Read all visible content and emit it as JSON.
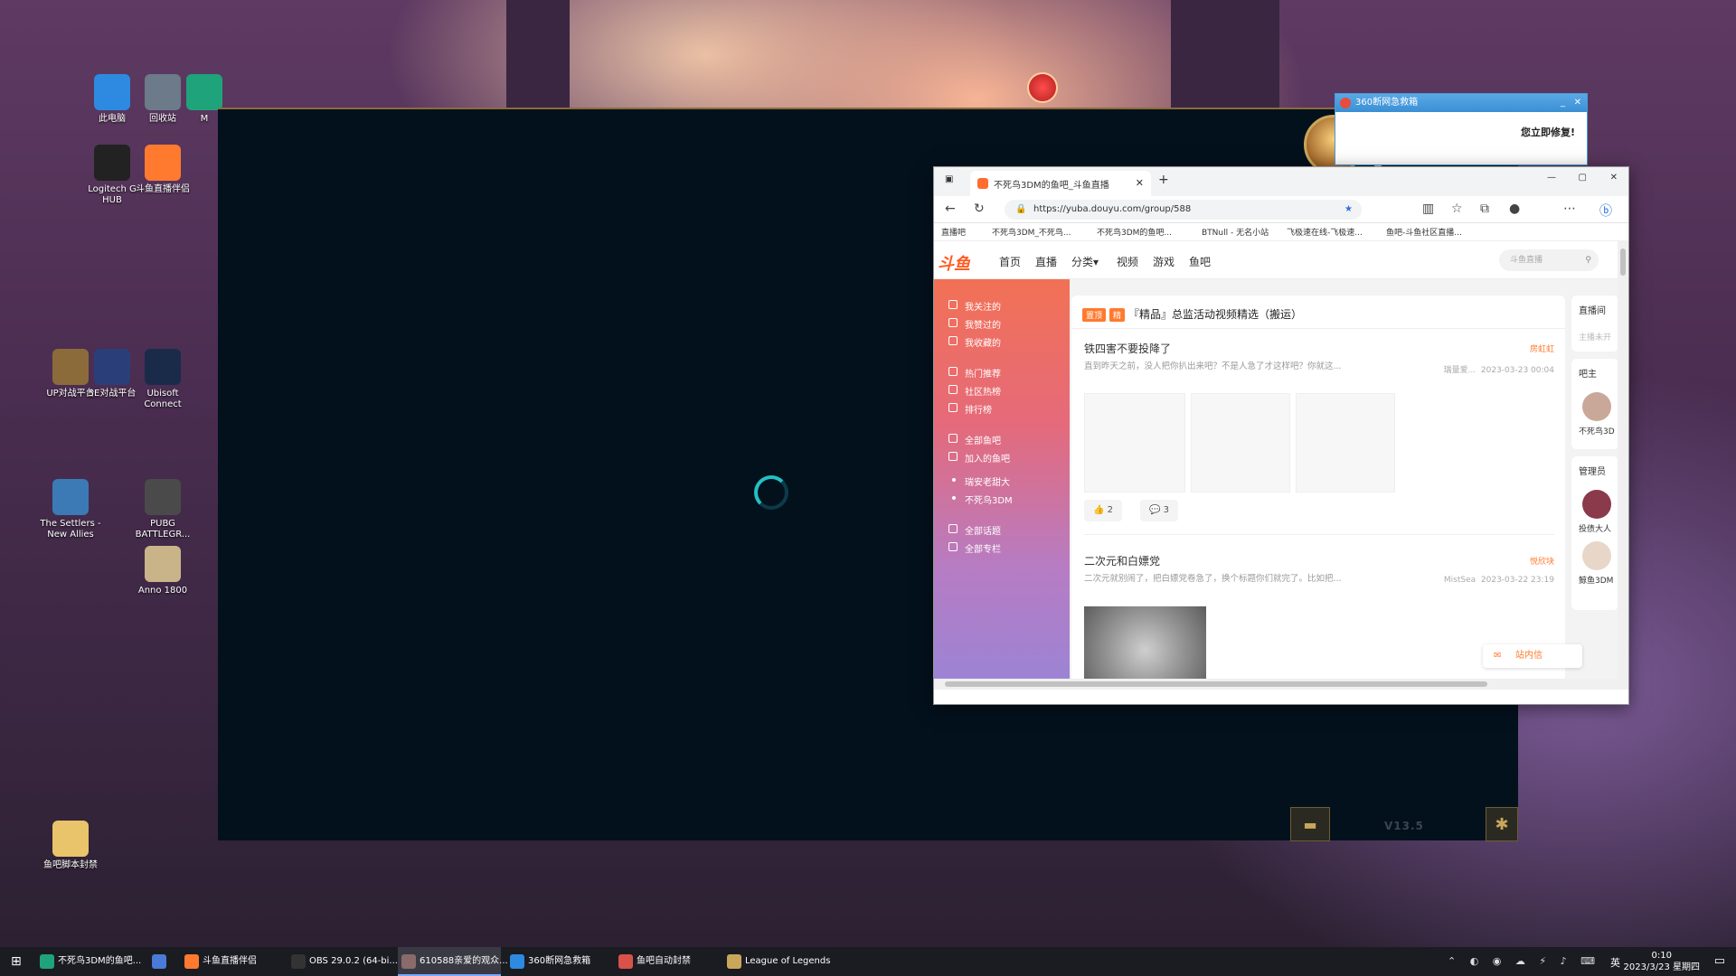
{
  "desktop": {
    "icons": [
      {
        "label": "此电脑",
        "icon": "computer-icon",
        "color": "#2d8ae0"
      },
      {
        "label": "回收站",
        "icon": "recycle-bin-icon",
        "color": "#6c7a89"
      },
      {
        "label": "M",
        "icon": "edge-icon",
        "color": "#1fa37a"
      },
      {
        "label": "Logitech G HUB",
        "icon": "logitech-icon",
        "color": "#222222"
      },
      {
        "label": "斗鱼直播伴侣",
        "icon": "douyu-icon",
        "color": "#ff7a2f"
      },
      {
        "label": "UP对战平台",
        "icon": "up-icon",
        "color": "#8b6b3a"
      },
      {
        "label": "5E对战平台",
        "icon": "5e-icon",
        "color": "#2a3f7a"
      },
      {
        "label": "Ubisoft Connect",
        "icon": "ubisoft-icon",
        "color": "#1a2b4a"
      },
      {
        "label": "The Settlers - New Allies",
        "icon": "settlers-icon",
        "color": "#3b7ab5"
      },
      {
        "label": "PUBG BATTLEGR...",
        "icon": "pubg-icon",
        "color": "#4a4a4a"
      },
      {
        "label": "Anno 1800",
        "icon": "anno-icon",
        "color": "#c9b48a"
      },
      {
        "label": "鱼吧脚本封禁",
        "icon": "folder-icon",
        "color": "#e9c46a"
      }
    ]
  },
  "launcher": {
    "version": "V13.5",
    "minimize": "—",
    "settings": "⚙",
    "close": "✕"
  },
  "popup360": {
    "title": "360断网急救箱",
    "body": "您立即修复!",
    "min": "_",
    "close": "✕"
  },
  "browser": {
    "tab_title": "不死鸟3DM的鱼吧_斗鱼直播",
    "url": "https://yuba.douyu.com/group/588",
    "bookmarks": [
      "直播吧",
      "不死鸟3DM_不死鸟...",
      "不死鸟3DM的鱼吧...",
      "BTNull - 无名小站",
      "飞极速在线-飞极速...",
      "鱼吧-斗鱼社区直播..."
    ],
    "site": {
      "logo": "斗鱼",
      "nav": [
        "首页",
        "直播",
        "分类▾",
        "视频",
        "游戏",
        "鱼吧"
      ],
      "search_placeholder": "斗鱼直播",
      "sidebar": [
        "我关注的",
        "我赞过的",
        "我收藏的",
        "热门推荐",
        "社区热榜",
        "排行榜",
        "全部鱼吧",
        "加入的鱼吧",
        "瑞安老甜大",
        "不死鸟3DM",
        "全部话题",
        "全部专栏"
      ],
      "pinned_tags": [
        "置顶",
        "精"
      ],
      "pinned_title": "『精品』总监活动视频精选（搬运）",
      "posts": [
        {
          "title": "铁四害不要投降了",
          "excerpt": "直到昨天之前，没人把你扒出来吧？不是人急了才这样吧？你就这...",
          "author": "房虹虹",
          "meta_name": "瑞量爱...",
          "time": "2023-03-23 00:04",
          "likes": "2",
          "comments": "3"
        },
        {
          "title": "二次元和白嫖党",
          "excerpt": "二次元就别闹了，把白嫖党卷急了，换个标题你们就完了。比如把...",
          "author": "悦欣块",
          "meta_name": "MistSea",
          "time": "2023-03-22 23:19"
        }
      ],
      "right": {
        "live": "直播间",
        "live_sub": "主播未开",
        "owner": "吧主",
        "owner_name": "不死鸟3D",
        "admins": "管理员",
        "admin1": "投债大人",
        "admin2": "鲸鱼3DM"
      },
      "message_btn": "站内信"
    }
  },
  "taskbar": {
    "items": [
      {
        "label": "不死鸟3DM的鱼吧...",
        "color": "#1fa37a"
      },
      {
        "label": "",
        "color": "#4a7bd8"
      },
      {
        "label": "斗鱼直播伴侣",
        "color": "#ff7a2f"
      },
      {
        "label": "OBS 29.0.2 (64-bi...",
        "color": "#333333"
      },
      {
        "label": "610588亲爱的观众...",
        "color": "#8a6a6a"
      },
      {
        "label": "360断网急救箱",
        "color": "#2d8ae0"
      },
      {
        "label": "鱼吧自动封禁",
        "color": "#d8524a"
      },
      {
        "label": "League of Legends",
        "color": "#c9a75a"
      }
    ],
    "ime": "英",
    "time": "0:10",
    "date": "2023/3/23 星期四"
  }
}
